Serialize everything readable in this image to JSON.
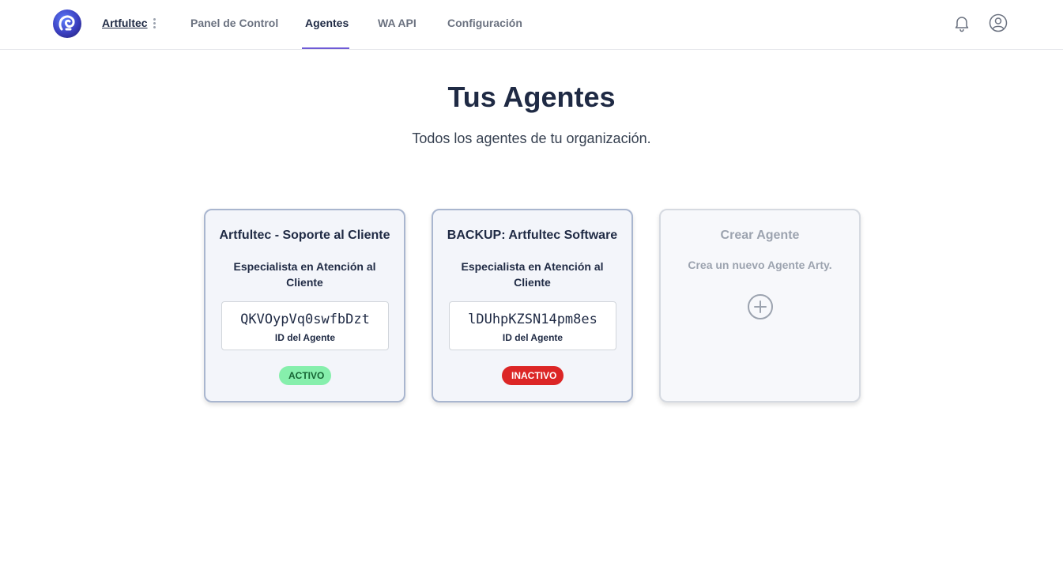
{
  "header": {
    "org_name": "Artfultec",
    "nav": [
      {
        "label": "Panel de Control",
        "active": false
      },
      {
        "label": "Agentes",
        "active": true
      },
      {
        "label": "WA API",
        "active": false
      },
      {
        "label": "Configuración",
        "active": false
      }
    ],
    "icons": [
      "bell-icon",
      "user-circle-icon"
    ],
    "accent_color": "#6f5bd6"
  },
  "page": {
    "title": "Tus Agentes",
    "subtitle": "Todos los agentes de tu organización."
  },
  "agents": [
    {
      "name": "Artfultec - Soporte al Cliente",
      "role": "Especialista en Atención al Cliente",
      "id": "QKVOypVq0swfbDzt",
      "id_label": "ID del Agente",
      "status": "ACTIVO",
      "status_color": "#86efac"
    },
    {
      "name": "BACKUP: Artfultec Software",
      "role": "Especialista en Atención al Cliente",
      "id": "lDUhpKZSN14pm8es",
      "id_label": "ID del Agente",
      "status": "INACTIVO",
      "status_color": "#dc2626"
    }
  ],
  "create_card": {
    "title": "Crear Agente",
    "description": "Crea un nuevo Agente Arty.",
    "icon": "plus-circle-icon"
  }
}
